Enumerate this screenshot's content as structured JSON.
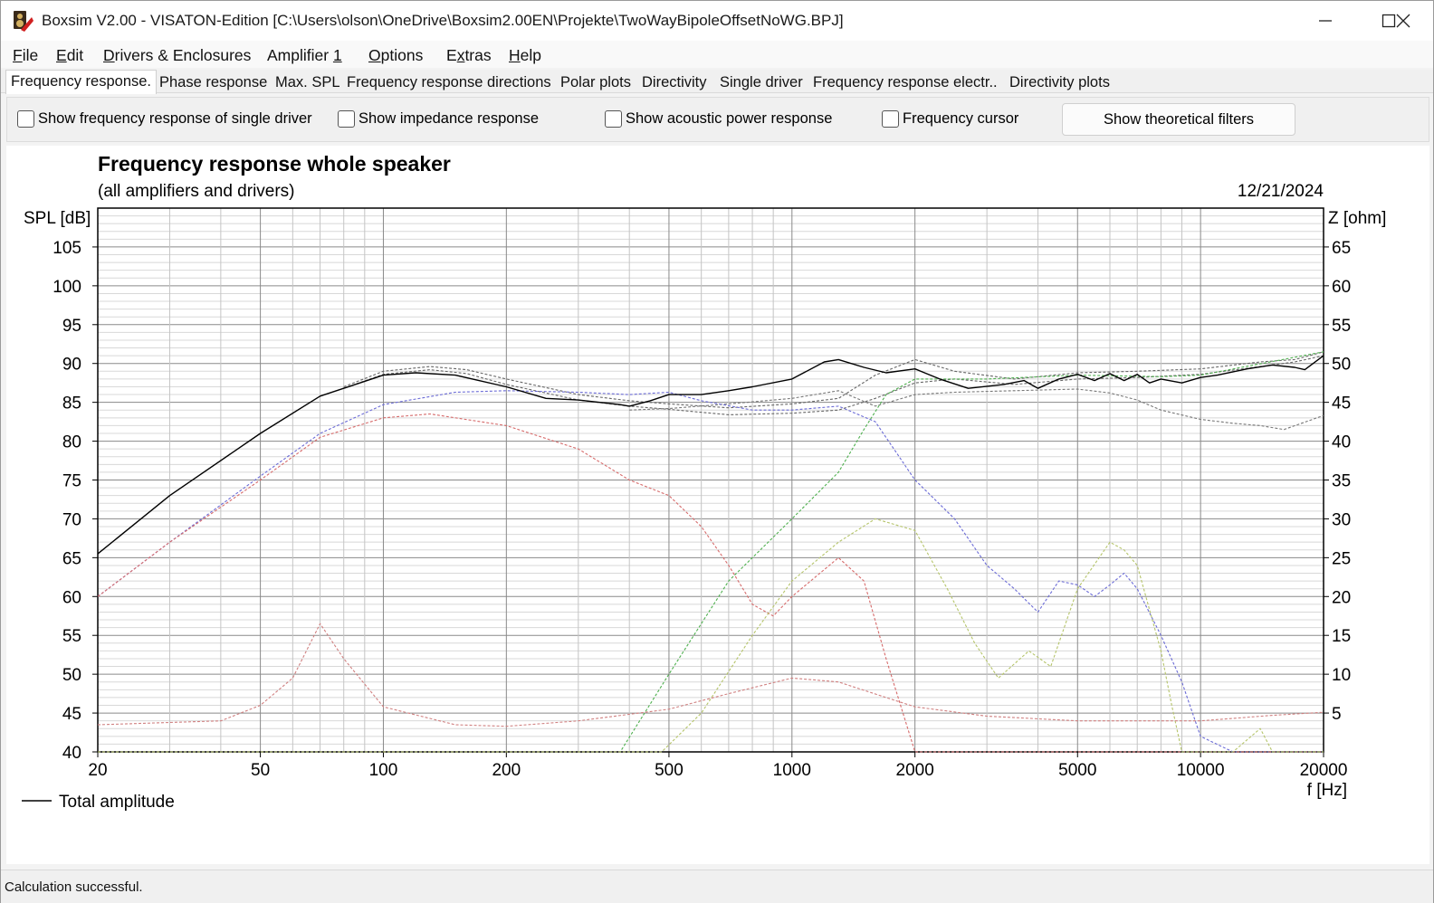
{
  "window": {
    "title": "Boxsim V2.00 - VISATON-Edition [C:\\Users\\olson\\OneDrive\\Boxsim2.00EN\\Projekte\\TwoWayBipoleOffsetNoWG.BPJ]"
  },
  "menu": {
    "items": [
      {
        "label": "File",
        "hotkey": "F"
      },
      {
        "label": "Edit",
        "hotkey": "E"
      },
      {
        "label": "Drivers & Enclosures",
        "hotkey": "D"
      },
      {
        "label": "Amplifier 1",
        "hotkey": "1"
      },
      {
        "label": "Options",
        "hotkey": "O"
      },
      {
        "label": "Extras",
        "hotkey": "x"
      },
      {
        "label": "Help",
        "hotkey": "H"
      }
    ]
  },
  "tabs": [
    {
      "label": "Frequency response.",
      "active": true
    },
    {
      "label": "Phase response"
    },
    {
      "label": "Max. SPL"
    },
    {
      "label": "Frequency response directions"
    },
    {
      "label": "Polar plots"
    },
    {
      "label": "Directivity"
    },
    {
      "label": "Single driver"
    },
    {
      "label": "Frequency response electr.."
    },
    {
      "label": "Directivity plots"
    }
  ],
  "options": {
    "show_single_driver": {
      "label": "Show frequency response of single driver",
      "checked": false
    },
    "show_impedance": {
      "label": "Show impedance response",
      "checked": false
    },
    "show_acoustic_power": {
      "label": "Show acoustic power response",
      "checked": false
    },
    "frequency_cursor": {
      "label": "Frequency cursor",
      "checked": false
    },
    "theoretical_filters_button": "Show theoretical filters"
  },
  "status": {
    "text": "Calculation successful."
  },
  "chart_data": {
    "type": "line",
    "title": "Frequency response whole speaker",
    "subtitle": "(all amplifiers and drivers)",
    "date": "12/21/2024",
    "ylabel": "SPL [dB]",
    "y2label": "Z [ohm]",
    "xlabel": "f [Hz]",
    "x_scale": "log",
    "xlim": [
      20,
      20000
    ],
    "ylim": [
      40,
      110
    ],
    "y2lim": [
      0,
      70
    ],
    "x_ticks": [
      20,
      50,
      100,
      200,
      500,
      1000,
      2000,
      5000,
      10000,
      20000
    ],
    "y_ticks": [
      40,
      45,
      50,
      55,
      60,
      65,
      70,
      75,
      80,
      85,
      90,
      95,
      100,
      105
    ],
    "y2_ticks": [
      5,
      10,
      15,
      20,
      25,
      30,
      35,
      40,
      45,
      50,
      55,
      60,
      65
    ],
    "grid": true,
    "legend": {
      "position": "bottom-left",
      "entries": [
        "Total amplitude"
      ]
    },
    "series": [
      {
        "name": "Total amplitude",
        "color": "#000000",
        "dash": false,
        "x": [
          20,
          30,
          50,
          70,
          100,
          120,
          150,
          200,
          250,
          300,
          380,
          400,
          450,
          500,
          600,
          700,
          800,
          1000,
          1200,
          1300,
          1500,
          1700,
          2000,
          2300,
          2700,
          3300,
          3700,
          4000,
          4500,
          5000,
          5500,
          6000,
          6500,
          7000,
          7500,
          8000,
          9000,
          10000,
          11000,
          13000,
          15000,
          17000,
          18000,
          20000
        ],
        "y": [
          65.5,
          73,
          81,
          85.8,
          88.5,
          88.8,
          88.5,
          87,
          85.5,
          85.3,
          84.7,
          84.5,
          85.2,
          86,
          86,
          86.5,
          87,
          88,
          90.2,
          90.5,
          89.5,
          88.8,
          89.3,
          88,
          86.8,
          87.3,
          87.8,
          86.8,
          88,
          88.6,
          87.8,
          88.7,
          87.8,
          88.6,
          87.5,
          88,
          87.5,
          88.2,
          88.5,
          89.3,
          89.8,
          89.5,
          89.2,
          91
        ]
      },
      {
        "name": "",
        "color": "#666666",
        "dash": true,
        "x": [
          80,
          100,
          130,
          160,
          200,
          300,
          400,
          500,
          700,
          1000,
          1300,
          1600,
          2000,
          2500,
          3500,
          5000,
          7000,
          10000,
          14000,
          17000,
          20000
        ],
        "y": [
          87,
          89,
          89.6,
          89.2,
          88,
          86,
          85.2,
          84.8,
          84.3,
          84.8,
          85.5,
          88.5,
          90.5,
          89,
          88,
          88.8,
          89,
          89.3,
          90.2,
          90.5,
          91.5
        ]
      },
      {
        "name": "",
        "color": "#666666",
        "dash": true,
        "x": [
          80,
          100,
          130,
          160,
          200,
          300,
          400,
          500,
          700,
          1000,
          1300,
          1600,
          2000,
          2500,
          3500,
          5000,
          7000,
          10000,
          14000,
          17000,
          20000
        ],
        "y": [
          86.8,
          88.6,
          89.2,
          88.7,
          87.3,
          85.3,
          84.5,
          84.1,
          83.4,
          83.6,
          84,
          85.5,
          87.5,
          88,
          87.3,
          88,
          88.2,
          88.6,
          89.6,
          90.2,
          91
        ]
      },
      {
        "name": "",
        "color": "#777777",
        "dash": true,
        "x": [
          400,
          500,
          700,
          1000,
          1300,
          1600,
          2000,
          2500,
          3500,
          5000,
          6000,
          7000,
          8000,
          10000,
          12000,
          14000,
          16000,
          20000
        ],
        "y": [
          84,
          84.2,
          84.8,
          85.5,
          86.5,
          84.5,
          86,
          86.3,
          86.5,
          86.7,
          86.2,
          85.3,
          84,
          82.8,
          82.3,
          82,
          81.5,
          83.3
        ]
      },
      {
        "name": "",
        "color": "#6b6bd6",
        "dash": true,
        "x": [
          20,
          30,
          50,
          70,
          100,
          150,
          200,
          300,
          400,
          500,
          600,
          800,
          1000,
          1300,
          1600,
          2000,
          2500,
          3000,
          3500,
          4000,
          4500,
          5000,
          5500,
          6000,
          6500,
          7000,
          8000,
          9000,
          10000,
          12000,
          20000
        ],
        "y": [
          60,
          67,
          75.5,
          81,
          84.7,
          86.3,
          86.5,
          86.3,
          86,
          86.3,
          85.2,
          84,
          84,
          84.5,
          82.5,
          75,
          70,
          64,
          61,
          58,
          62,
          61.5,
          60,
          61.5,
          63,
          61,
          55,
          49,
          42,
          40,
          40
        ]
      },
      {
        "name": "",
        "color": "#d66b6b",
        "dash": true,
        "x": [
          20,
          30,
          50,
          70,
          100,
          130,
          200,
          300,
          400,
          500,
          600,
          700,
          800,
          900,
          1000,
          1300,
          1500,
          1700,
          2000,
          2500,
          20000
        ],
        "y": [
          60,
          67,
          75,
          80.5,
          83,
          83.5,
          82,
          79,
          75,
          73,
          69,
          64,
          59,
          57.5,
          60,
          65,
          62,
          52,
          40,
          40,
          40
        ]
      },
      {
        "name": "",
        "color": "#4fb04f",
        "dash": true,
        "x": [
          20,
          380,
          500,
          700,
          1000,
          1300,
          1500,
          1700,
          2000,
          3000,
          5000,
          8000,
          10000,
          20000
        ],
        "y": [
          40,
          40,
          50,
          62,
          70,
          76,
          81.5,
          86,
          88,
          88,
          88.5,
          88.3,
          88.5,
          91.5
        ]
      },
      {
        "name": "",
        "color": "#b5c46a",
        "dash": true,
        "x": [
          20,
          480,
          600,
          800,
          1000,
          1300,
          1600,
          2000,
          2400,
          2800,
          3200,
          3800,
          4300,
          5000,
          6000,
          6500,
          7000,
          8000,
          8500,
          9000,
          10000,
          12000,
          14000,
          15000,
          20000
        ],
        "y": [
          40,
          40,
          45,
          55,
          62,
          67,
          70,
          68.5,
          61,
          54,
          49.5,
          53,
          51,
          61,
          67,
          66,
          64,
          53,
          46,
          40,
          40,
          40,
          43,
          40,
          40
        ]
      },
      {
        "name": "",
        "color": "#d08080",
        "dash": true,
        "x": [
          20,
          40,
          50,
          60,
          70,
          80,
          100,
          150,
          200,
          300,
          500,
          700,
          1000,
          1300,
          1700,
          2000,
          3000,
          5000,
          8000,
          10000,
          15000,
          20000
        ],
        "y": [
          43.5,
          44,
          46,
          49.5,
          56.5,
          52,
          45.8,
          43.5,
          43.3,
          44,
          45.5,
          47.5,
          49.5,
          49,
          47,
          45.8,
          44.6,
          44,
          44,
          44,
          44.7,
          45.1
        ]
      }
    ]
  }
}
